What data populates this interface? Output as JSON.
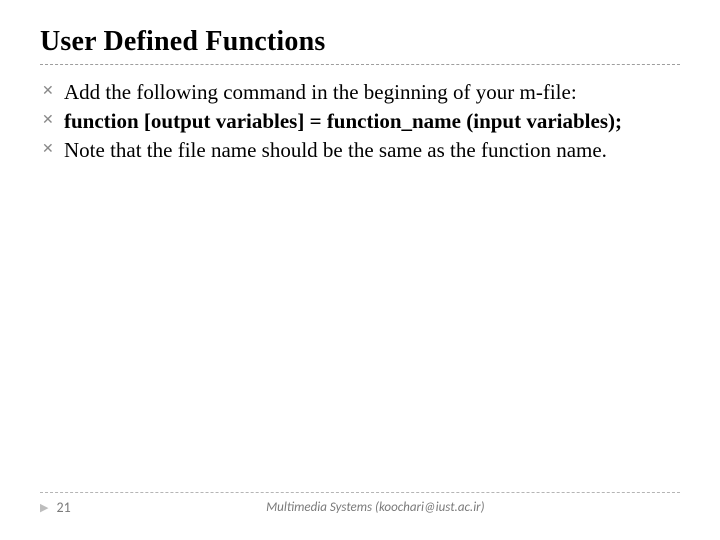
{
  "title": "User Defined Functions",
  "bullets": [
    {
      "text": "Add the following command in the beginning of your m-file:"
    },
    {
      "text": "function [output variables] = function_name (input variables);",
      "bold": true
    },
    {
      "text": "Note that the file name should be the same as the function name."
    }
  ],
  "footer": {
    "page": "21",
    "center": "Multimedia Systems (koochari@iust.ac.ir)"
  }
}
